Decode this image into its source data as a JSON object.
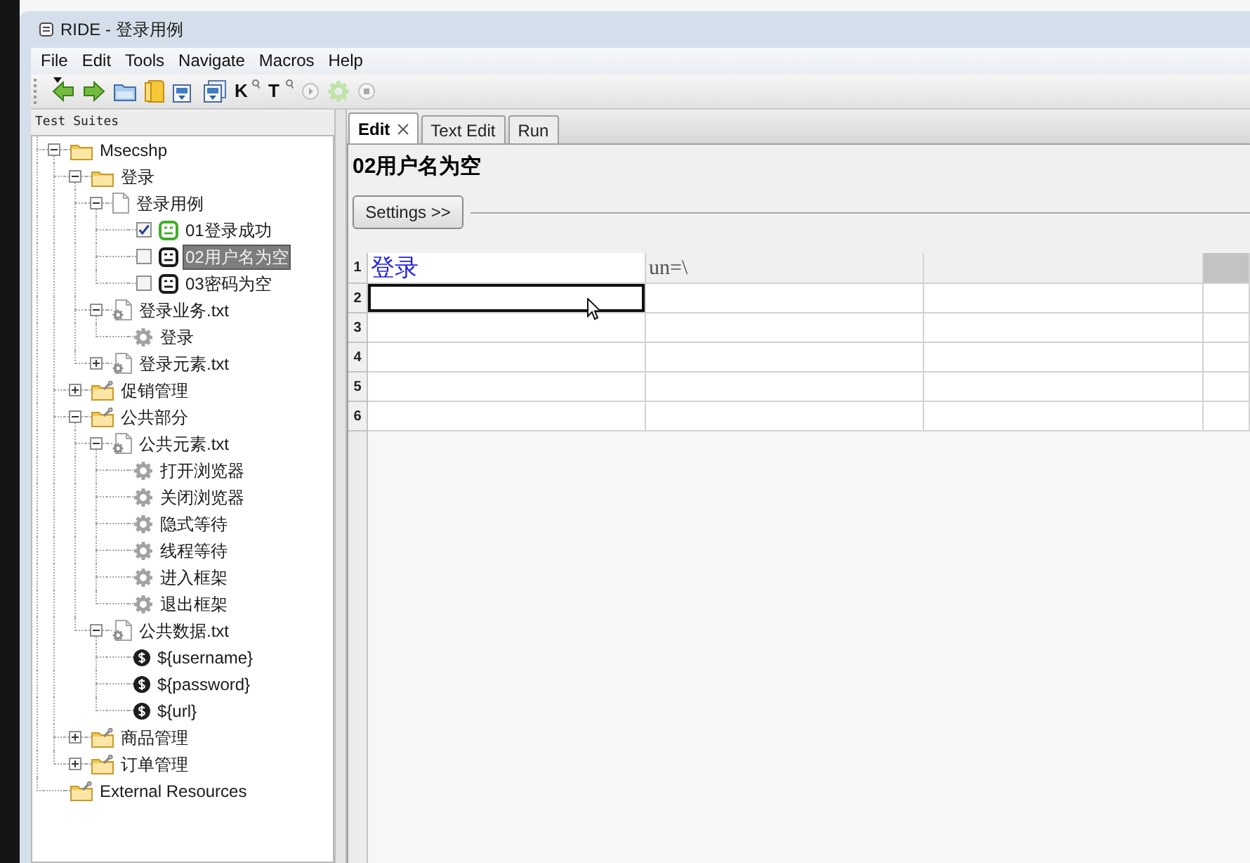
{
  "window": {
    "title": "RIDE - 登录用例"
  },
  "menu": [
    "File",
    "Edit",
    "Tools",
    "Navigate",
    "Macros",
    "Help"
  ],
  "toolbar": [
    {
      "kind": "back",
      "disabled": false
    },
    {
      "kind": "forward",
      "disabled": false
    },
    {
      "kind": "open",
      "disabled": false
    },
    {
      "kind": "open_directory",
      "disabled": false
    },
    {
      "kind": "save",
      "disabled": false
    },
    {
      "kind": "save_all",
      "disabled": false
    },
    {
      "kind": "search_keywords",
      "label": "K",
      "disabled": false
    },
    {
      "kind": "search_tests",
      "label": "T",
      "disabled": false
    },
    {
      "kind": "run",
      "disabled": true
    },
    {
      "kind": "run_settings",
      "disabled": true
    },
    {
      "kind": "stop",
      "disabled": true
    }
  ],
  "tree": {
    "title": "Test Suites",
    "items": [
      {
        "label": "Msecshp",
        "kind": "suite_folder",
        "expanded": true,
        "selected": false,
        "children": [
          {
            "label": "登录",
            "kind": "suite_folder",
            "expanded": true,
            "selected": false,
            "children": [
              {
                "label": "登录用例",
                "kind": "suite_file",
                "expanded": true,
                "selected": false,
                "children": [
                  {
                    "label": "01登录成功",
                    "kind": "test",
                    "checked": true,
                    "color": "#3fae2a",
                    "selected": false
                  },
                  {
                    "label": "02用户名为空",
                    "kind": "test",
                    "checked": false,
                    "color": "#1a1a1a",
                    "selected": true
                  },
                  {
                    "label": "03密码为空",
                    "kind": "test",
                    "checked": false,
                    "color": "#1a1a1a",
                    "selected": false
                  }
                ]
              },
              {
                "label": "登录业务.txt",
                "kind": "resource_file",
                "expanded": true,
                "selected": false,
                "children": [
                  {
                    "label": "登录",
                    "kind": "keyword",
                    "selected": false
                  }
                ]
              },
              {
                "label": "登录元素.txt",
                "kind": "resource_file",
                "expanded": false,
                "selected": false
              }
            ]
          },
          {
            "label": "促销管理",
            "kind": "resource_folder",
            "expanded": false,
            "selected": false
          },
          {
            "label": "公共部分",
            "kind": "resource_folder",
            "expanded": true,
            "selected": false,
            "children": [
              {
                "label": "公共元素.txt",
                "kind": "resource_file",
                "expanded": true,
                "selected": false,
                "children": [
                  {
                    "label": "打开浏览器",
                    "kind": "keyword",
                    "selected": false
                  },
                  {
                    "label": "关闭浏览器",
                    "kind": "keyword",
                    "selected": false
                  },
                  {
                    "label": "隐式等待",
                    "kind": "keyword",
                    "selected": false
                  },
                  {
                    "label": "线程等待",
                    "kind": "keyword",
                    "selected": false
                  },
                  {
                    "label": "进入框架",
                    "kind": "keyword",
                    "selected": false
                  },
                  {
                    "label": "退出框架",
                    "kind": "keyword",
                    "selected": false
                  }
                ]
              },
              {
                "label": "公共数据.txt",
                "kind": "resource_file",
                "expanded": true,
                "selected": false,
                "children": [
                  {
                    "label": "${username}",
                    "kind": "variable",
                    "selected": false
                  },
                  {
                    "label": "${password}",
                    "kind": "variable",
                    "selected": false
                  },
                  {
                    "label": "${url}",
                    "kind": "variable",
                    "selected": false
                  }
                ]
              }
            ]
          },
          {
            "label": "商品管理",
            "kind": "resource_folder",
            "expanded": false,
            "selected": false
          },
          {
            "label": "订单管理",
            "kind": "resource_folder",
            "expanded": false,
            "selected": false
          }
        ]
      },
      {
        "label": "External Resources",
        "kind": "resource_folder",
        "selected": false
      }
    ]
  },
  "tabs": [
    {
      "label": "Edit",
      "selected": true,
      "closable": true
    },
    {
      "label": "Text Edit",
      "selected": false,
      "closable": false
    },
    {
      "label": "Run",
      "selected": false,
      "closable": false
    }
  ],
  "editor": {
    "title": "02用户名为空",
    "settings_button": "Settings >>",
    "grid": {
      "rows": [
        {
          "label": "1",
          "cells": [
            {
              "text": "登录",
              "kind": "keyword",
              "color": "#ffffff",
              "selected": false
            },
            {
              "text": "un=\\",
              "kind": "argument",
              "color": "#f0f0f0",
              "selected": false
            },
            {
              "kind": "empty",
              "color": "#f0f0f0",
              "selected": false
            },
            {
              "kind": "empty",
              "color": "#c3c3c3",
              "selected": false
            }
          ]
        },
        {
          "label": "2",
          "cells": [
            {
              "kind": "empty",
              "color": "#ffffff",
              "selected": true
            },
            {
              "kind": "empty",
              "color": "#ffffff",
              "selected": false
            },
            {
              "kind": "empty",
              "color": "#ffffff",
              "selected": false
            },
            {
              "kind": "empty",
              "color": "#ffffff",
              "selected": false
            }
          ]
        },
        {
          "label": "3",
          "cells": [
            {
              "kind": "empty",
              "color": "#ffffff",
              "selected": false
            },
            {
              "kind": "empty",
              "color": "#ffffff",
              "selected": false
            },
            {
              "kind": "empty",
              "color": "#ffffff",
              "selected": false
            },
            {
              "kind": "empty",
              "color": "#ffffff",
              "selected": false
            }
          ]
        },
        {
          "label": "4",
          "cells": [
            {
              "kind": "empty",
              "color": "#ffffff",
              "selected": false
            },
            {
              "kind": "empty",
              "color": "#ffffff",
              "selected": false
            },
            {
              "kind": "empty",
              "color": "#ffffff",
              "selected": false
            },
            {
              "kind": "empty",
              "color": "#ffffff",
              "selected": false
            }
          ]
        },
        {
          "label": "5",
          "cells": [
            {
              "kind": "empty",
              "color": "#ffffff",
              "selected": false
            },
            {
              "kind": "empty",
              "color": "#ffffff",
              "selected": false
            },
            {
              "kind": "empty",
              "color": "#ffffff",
              "selected": false
            },
            {
              "kind": "empty",
              "color": "#ffffff",
              "selected": false
            }
          ]
        },
        {
          "label": "6",
          "cells": [
            {
              "kind": "empty",
              "color": "#ffffff",
              "selected": false
            },
            {
              "kind": "empty",
              "color": "#ffffff",
              "selected": false
            },
            {
              "kind": "empty",
              "color": "#ffffff",
              "selected": false
            },
            {
              "kind": "empty",
              "color": "#ffffff",
              "selected": false
            }
          ]
        }
      ]
    }
  }
}
